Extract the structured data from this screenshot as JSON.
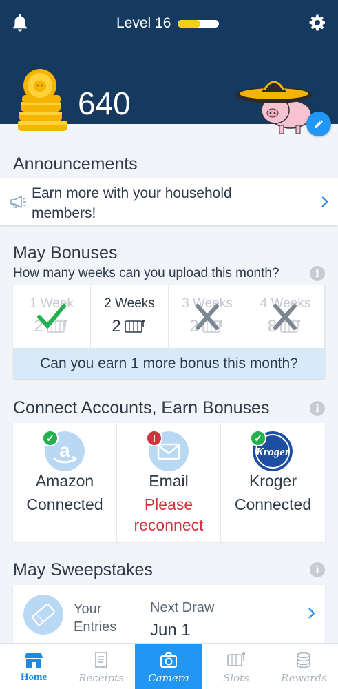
{
  "header": {
    "level_label": "Level 16",
    "level_progress": 0.55,
    "points": "640",
    "icons": [
      "bell-icon",
      "gear-icon",
      "coin-stack-icon",
      "pig-mascot-icon",
      "pencil-icon"
    ]
  },
  "announcements": {
    "title": "Announcements",
    "message_line1": "Earn more with your household",
    "message_line2": "members!"
  },
  "bonuses": {
    "title": "May Bonuses",
    "subtitle": "How many weeks can you upload this month?",
    "weeks": [
      {
        "label": "1 Week",
        "value": "2",
        "state": "achieved"
      },
      {
        "label": "2 Weeks",
        "value": "2",
        "state": "current"
      },
      {
        "label": "3 Weeks",
        "value": "2",
        "state": "missed"
      },
      {
        "label": "4 Weeks",
        "value": "8",
        "state": "missed"
      }
    ],
    "banner": "Can you earn 1 more bonus this month?"
  },
  "connect": {
    "title": "Connect Accounts, Earn Bonuses",
    "accounts": [
      {
        "name": "Amazon",
        "status": "Connected",
        "badge": "check"
      },
      {
        "name": "Email",
        "status_line1": "Please",
        "status_line2": "reconnect",
        "badge": "!"
      },
      {
        "name": "Kroger",
        "status": "Connected",
        "badge": "check",
        "logo_text": "Kroger"
      }
    ]
  },
  "sweepstakes": {
    "title": "May Sweepstakes",
    "entries_line1": "Your",
    "entries_line2": "Entries",
    "next_draw_label": "Next Draw",
    "next_draw_date": "Jun 1"
  },
  "nav": {
    "items": [
      {
        "label": "Home"
      },
      {
        "label": "Receipts"
      },
      {
        "label": "Camera"
      },
      {
        "label": "Slots"
      },
      {
        "label": "Rewards"
      }
    ]
  },
  "colors": {
    "header_bg": "#163a5f",
    "accent": "#2196f3",
    "level_fill": "#f5cf16",
    "success": "#22b14c",
    "warning": "#d0333b"
  }
}
